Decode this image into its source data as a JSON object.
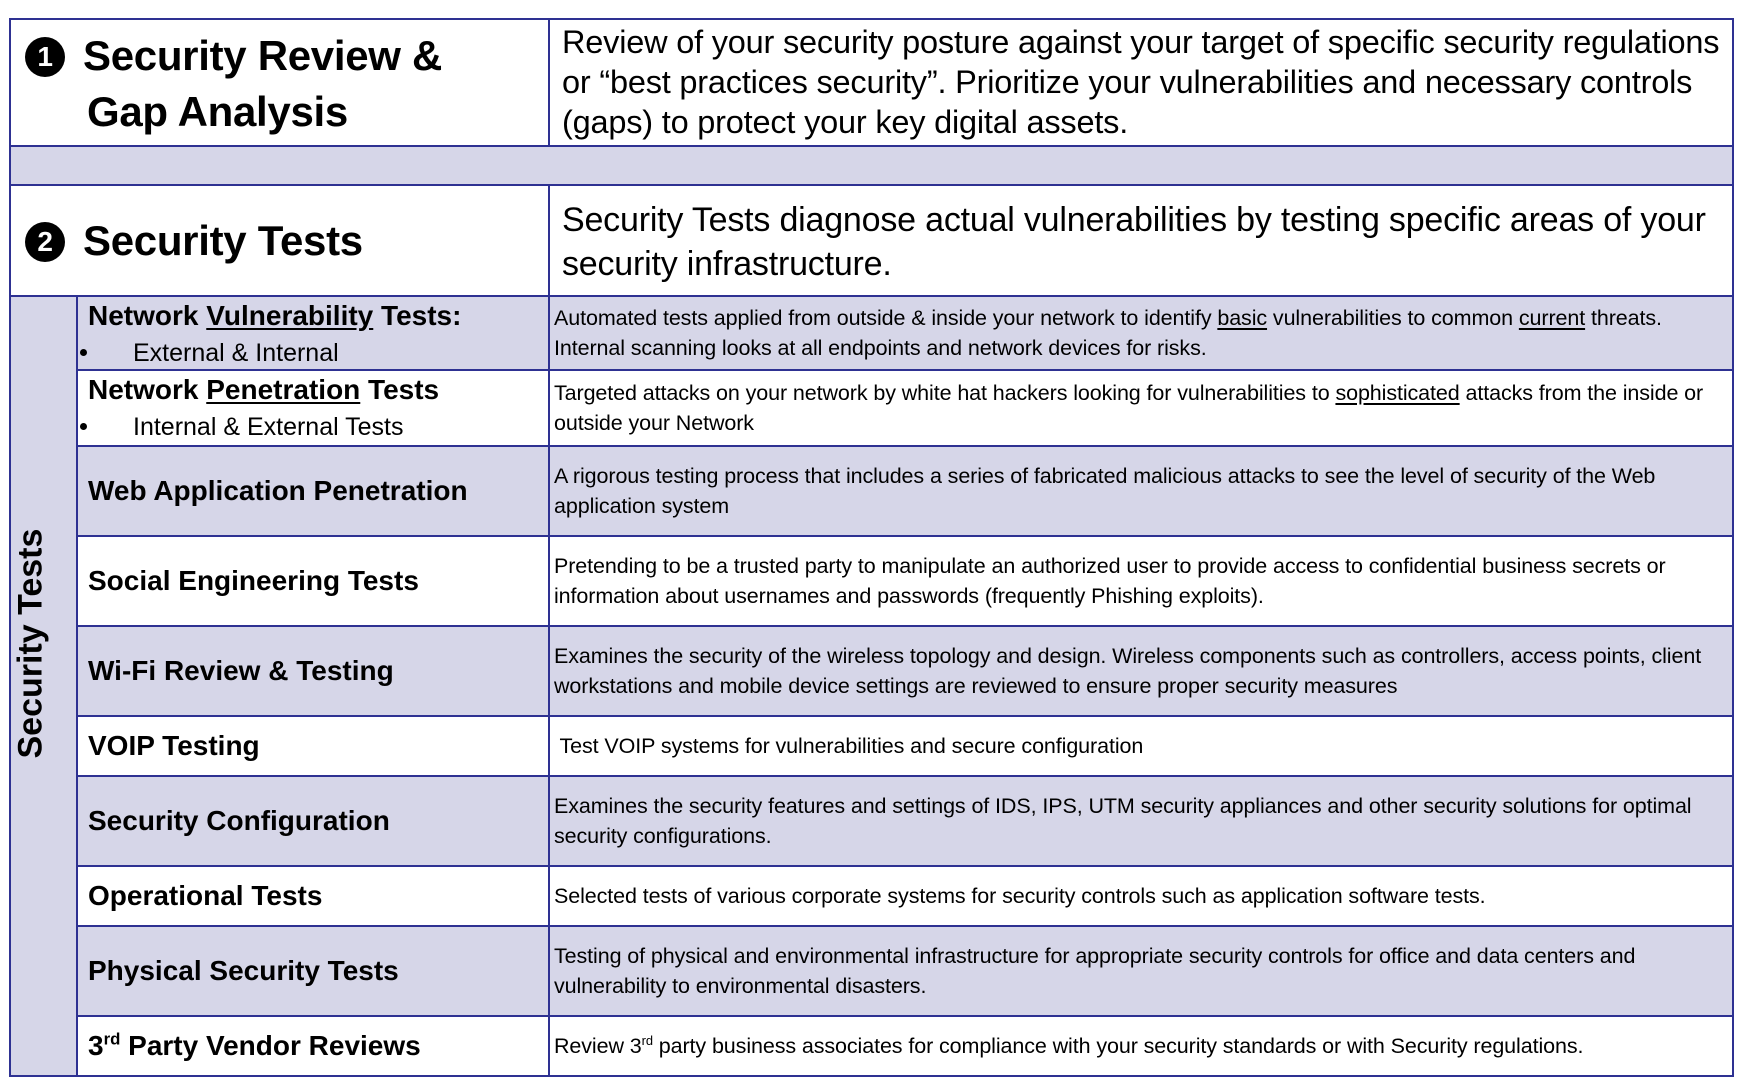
{
  "section1": {
    "number": "1",
    "title_line1": "Security Review &",
    "title_line2": "Gap Analysis",
    "description": "Review of your security posture against your target of specific security regulations or “best practices security”.  Prioritize your vulnerabilities and necessary controls (gaps) to protect your key digital assets."
  },
  "section2": {
    "number": "2",
    "title": "Security Tests",
    "description": "Security Tests diagnose actual vulnerabilities by testing specific areas of your security infrastructure.",
    "side_label": "Security Tests"
  },
  "tests": [
    {
      "name_pre": "Network ",
      "name_underlined": "Vulnerability",
      "name_post": " Tests:",
      "bullet": "External & Internal",
      "desc_parts": [
        "Automated tests applied from outside & inside your network to identify ",
        "basic",
        " vulnerabilities to common ",
        "current",
        " threats. Internal scanning looks at all endpoints and network devices for risks."
      ]
    },
    {
      "name_pre": "Network ",
      "name_underlined": "Penetration",
      "name_post": " Tests",
      "bullet": "Internal & External Tests",
      "desc_parts": [
        "Targeted attacks on your network by white hat hackers looking for vulnerabilities to ",
        "sophisticated",
        " attacks from the inside or outside your Network"
      ]
    },
    {
      "name": "Web Application Penetration",
      "description": "A rigorous testing process that includes a series of fabricated malicious attacks to see the level of security of the Web application system"
    },
    {
      "name": "Social Engineering Tests",
      "description": "Pretending to be a trusted party to manipulate an authorized user to provide access to confidential business secrets or information about usernames and passwords (frequently Phishing exploits)."
    },
    {
      "name": "Wi-Fi Review & Testing",
      "description": "Examines the security of the wireless topology and design. Wireless components such as controllers, access points, client workstations and mobile device settings are reviewed to ensure proper security measures"
    },
    {
      "name": "VOIP Testing",
      "description": " Test VOIP systems for vulnerabilities and secure configuration"
    },
    {
      "name": "Security Configuration",
      "description": "Examines the security features and settings of IDS, IPS, UTM security appliances and other security solutions for optimal security configurations."
    },
    {
      "name": "Operational Tests",
      "description": "Selected tests of various corporate systems for security controls such as application software tests."
    },
    {
      "name": "Physical Security Tests",
      "description": "Testing of physical and environmental infrastructure for appropriate security controls for office and data centers and vulnerability to environmental disasters."
    },
    {
      "name_num": "3",
      "name_sup": "rd",
      "name_rest": " Party Vendor Reviews",
      "desc_pre": "Review 3",
      "desc_sup": "rd",
      "desc_post": " party business associates for compliance with your security standards or with Security regulations."
    }
  ],
  "colors": {
    "border": "#2E3192",
    "shaded_row": "#D6D6E8",
    "background": "#FFFFFF"
  }
}
